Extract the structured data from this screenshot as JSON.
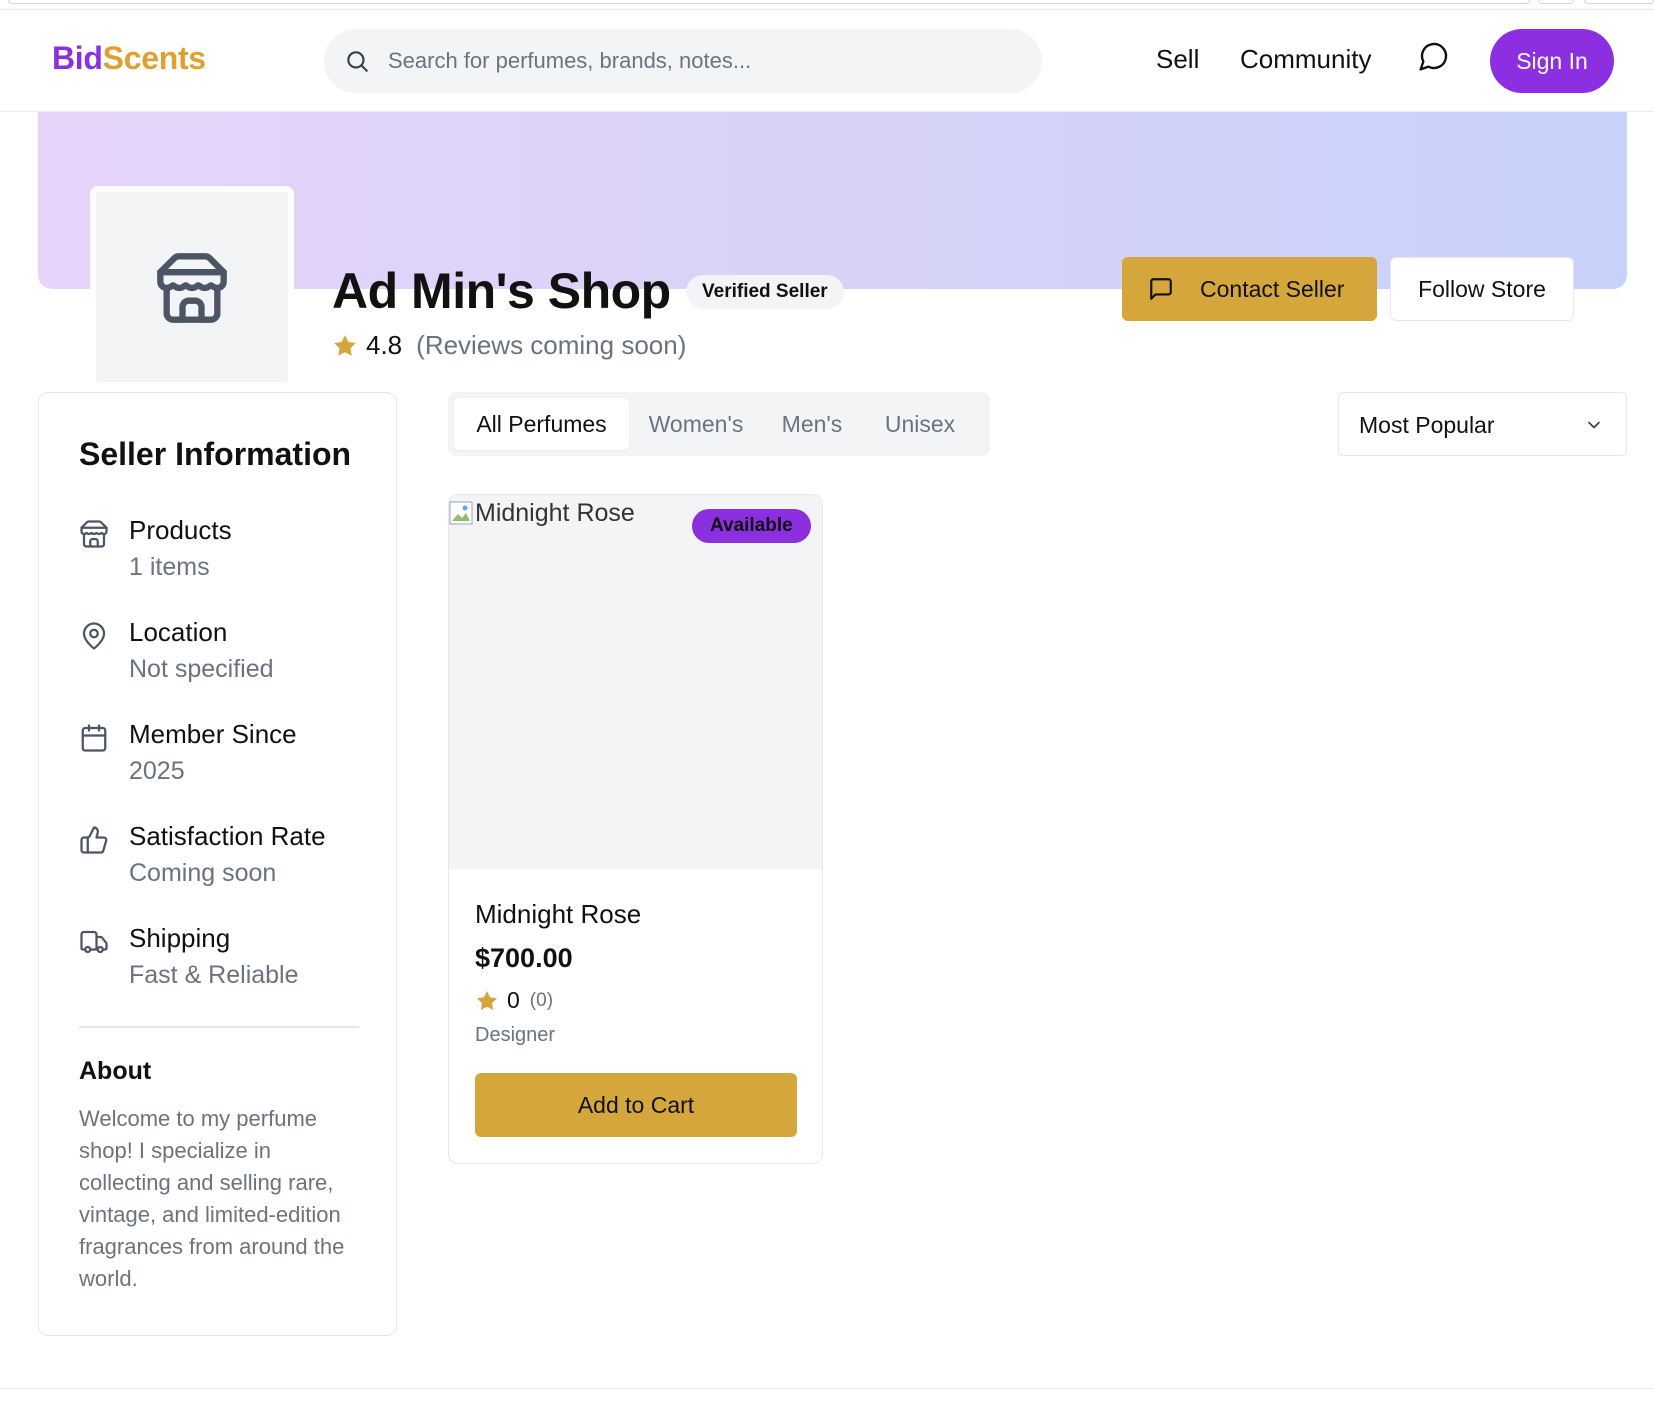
{
  "brand": {
    "part1": "Bid",
    "part2": "Scents"
  },
  "search": {
    "placeholder": "Search for perfumes, brands, notes..."
  },
  "nav": {
    "sell": "Sell",
    "community": "Community",
    "sign_in": "Sign In"
  },
  "shop": {
    "title": "Ad Min's Shop",
    "verified_badge": "Verified Seller",
    "rating": "4.8",
    "rating_note": "(Reviews coming soon)",
    "contact_label": "Contact Seller",
    "follow_label": "Follow Store"
  },
  "seller_info": {
    "heading": "Seller Information",
    "items": [
      {
        "icon": "store-icon",
        "title": "Products",
        "value": "1 items"
      },
      {
        "icon": "map-pin-icon",
        "title": "Location",
        "value": "Not specified"
      },
      {
        "icon": "calendar-icon",
        "title": "Member Since",
        "value": "2025"
      },
      {
        "icon": "thumbs-up-icon",
        "title": "Satisfaction Rate",
        "value": "Coming soon"
      },
      {
        "icon": "truck-icon",
        "title": "Shipping",
        "value": "Fast & Reliable"
      }
    ],
    "about_heading": "About",
    "about_text": "Welcome to my perfume shop! I specialize in collecting and selling rare, vintage, and limited-edition fragrances from around the world."
  },
  "tabs": [
    "All Perfumes",
    "Women's",
    "Men's",
    "Unisex"
  ],
  "sort": {
    "selected": "Most Popular"
  },
  "products": [
    {
      "image_alt": "Midnight Rose",
      "badge": "Available",
      "name": "Midnight Rose",
      "price": "$700.00",
      "rating": "0",
      "rating_count": "(0)",
      "category": "Designer",
      "cart_label": "Add to Cart"
    }
  ],
  "colors": {
    "brand_purple": "#8b2fe0",
    "brand_gold": "#e0a030",
    "button_gold": "#d4a63c",
    "star": "#d4a63c",
    "muted_text": "#6b7280"
  }
}
